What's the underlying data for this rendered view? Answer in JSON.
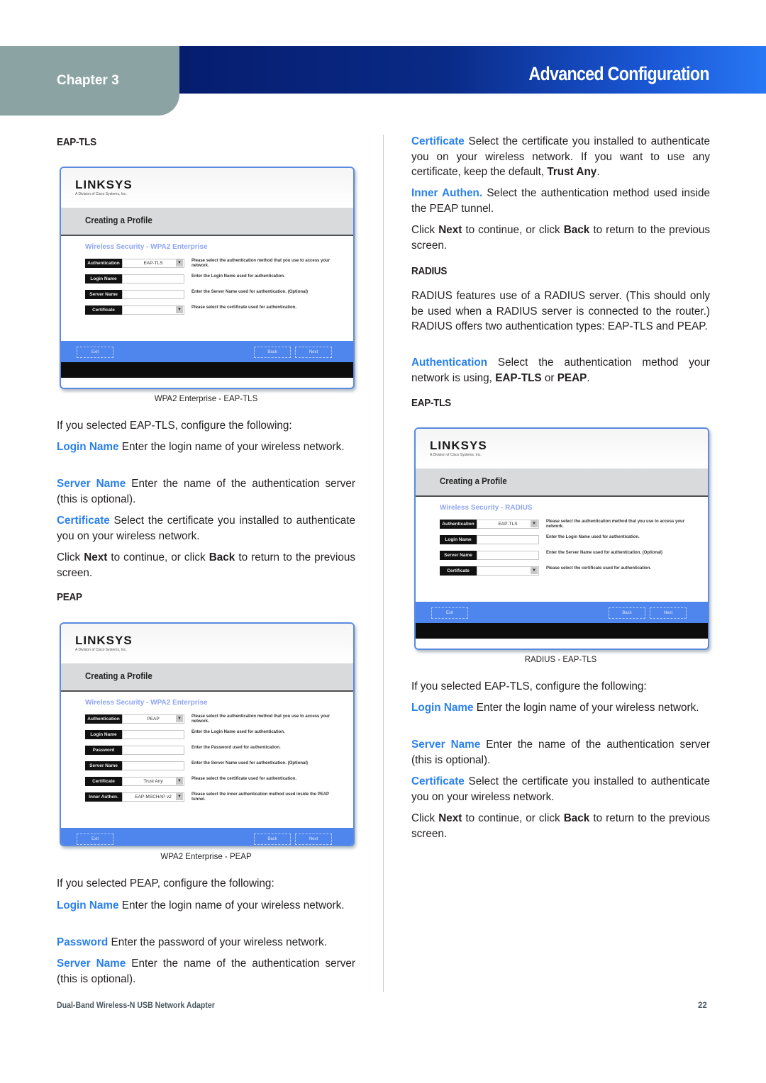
{
  "header": {
    "chapter": "Chapter 3",
    "title": "Advanced Configuration",
    "colors": {
      "chapter_tab": "#8ca3a4",
      "bar_start": "#061d6e",
      "bar_end": "#2877f4",
      "term": "#2a80ee"
    }
  },
  "left": {
    "eap_tls_heading": "EAP-TLS",
    "shot1": {
      "logo": "LINKSYS",
      "logo_sub": "A Division of Cisco Systems, Inc.",
      "band_title": "Creating a Profile",
      "section_title": "Wireless Security - WPA2 Enterprise",
      "rows": [
        {
          "label": "Authentication",
          "value": "EAP-TLS",
          "dropdown": true,
          "hint": "Please select the authentication method that you use to access your network."
        },
        {
          "label": "Login Name",
          "value": "",
          "dropdown": false,
          "hint": "Enter the Login Name used for authentication."
        },
        {
          "label": "Server Name",
          "value": "",
          "dropdown": false,
          "hint": "Enter the Server Name used for authentication. (Optional)"
        },
        {
          "label": "Certificate",
          "value": "",
          "dropdown": true,
          "hint": "Please select the certificate used for authentication."
        }
      ],
      "buttons": {
        "exit": "Exit",
        "back": "Back",
        "next": "Next"
      },
      "caption": "WPA2 Enterprise - EAP-TLS"
    },
    "intro1": "If you selected EAP-TLS, configure the following:",
    "p_login": {
      "term": "Login Name",
      "text": " Enter the login name of your wireless network."
    },
    "p_server": {
      "term": "Server Name",
      "text": "  Enter the name of the authentication server (this is optional)."
    },
    "p_cert": {
      "term": "Certificate",
      "text": " Select the certificate you installed to authenticate you on your wireless network."
    },
    "p_click": {
      "a": "Click ",
      "next": "Next",
      "b": " to continue, or click ",
      "back": "Back",
      "c": " to return to the previous screen."
    },
    "peap_heading": "PEAP",
    "shot2": {
      "logo": "LINKSYS",
      "logo_sub": "A Division of Cisco Systems, Inc.",
      "band_title": "Creating a Profile",
      "section_title": "Wireless Security - WPA2 Enterprise",
      "rows": [
        {
          "label": "Authentication",
          "value": "PEAP",
          "dropdown": true,
          "hint": "Please select the authentication method that you use to access your network."
        },
        {
          "label": "Login Name",
          "value": "",
          "dropdown": false,
          "hint": "Enter the Login Name used for authentication."
        },
        {
          "label": "Password",
          "value": "",
          "dropdown": false,
          "hint": "Enter the Password used for authentication."
        },
        {
          "label": "Server Name",
          "value": "",
          "dropdown": false,
          "hint": "Enter the Server Name used for authentication. (Optional)"
        },
        {
          "label": "Certificate",
          "value": "Trust Any",
          "dropdown": true,
          "hint": "Please select the certificate used for authentication."
        },
        {
          "label": "Inner Authen.",
          "value": "EAP-MSCHAP v2",
          "dropdown": true,
          "hint": "Please select the inner authentication method used inside the PEAP tunnel."
        }
      ],
      "buttons": {
        "exit": "Exit",
        "back": "Back",
        "next": "Next"
      },
      "caption": "WPA2 Enterprise - PEAP"
    },
    "intro2": "If you selected PEAP, configure the following:",
    "p2_login": {
      "term": "Login Name",
      "text": " Enter the login name of your wireless network."
    },
    "p2_password": {
      "term": "Password",
      "text": "  Enter the password of your wireless network."
    },
    "p2_server": {
      "term": "Server Name",
      "text": "  Enter the name of the authentication server (this is optional)."
    }
  },
  "right": {
    "p_cert": {
      "term": "Certificate",
      "text": " Select the certificate you installed to authenticate you on your wireless network. If you want to use any certificate, keep the default, ",
      "bold": "Trust Any",
      "end": "."
    },
    "p_inner": {
      "term": "Inner Authen.",
      "text": " Select the authentication method used inside the PEAP tunnel."
    },
    "p_click": {
      "a": "Click ",
      "next": "Next",
      "b": " to continue, or click ",
      "back": "Back",
      "c": " to return to the previous screen."
    },
    "radius_heading": "RADIUS",
    "radius_para": "RADIUS features use of a RADIUS server. (This should only be used when a RADIUS server is connected to the router.) RADIUS offers two authentication types: EAP-TLS and PEAP.",
    "p_auth": {
      "term": "Authentication",
      "text": "  Select the authentication method your network is using, ",
      "opt1": "EAP-TLS",
      "or": " or ",
      "opt2": "PEAP",
      "end": "."
    },
    "eap_tls_heading": "EAP-TLS",
    "shot3": {
      "logo": "LINKSYS",
      "logo_sub": "A Division of Cisco Systems, Inc.",
      "band_title": "Creating a Profile",
      "section_title": "Wireless Security - RADIUS",
      "rows": [
        {
          "label": "Authentication",
          "value": "EAP-TLS",
          "dropdown": true,
          "hint": "Please select the authentication method that you use to access your network."
        },
        {
          "label": "Login Name",
          "value": "",
          "dropdown": false,
          "hint": "Enter the Login Name used for authentication."
        },
        {
          "label": "Server Name",
          "value": "",
          "dropdown": false,
          "hint": "Enter the Server Name used for authentication. (Optional)"
        },
        {
          "label": "Certificate",
          "value": "",
          "dropdown": true,
          "hint": "Please select the certificate used for authentication."
        }
      ],
      "buttons": {
        "exit": "Exit",
        "back": "Back",
        "next": "Next"
      },
      "caption": "RADIUS - EAP-TLS"
    },
    "intro": "If you selected EAP-TLS, configure the following:",
    "p2_login": {
      "term": "Login Name",
      "text": " Enter the login name of your wireless network."
    },
    "p2_server": {
      "term": "Server Name",
      "text": "  Enter the name of the authentication server (this is optional)."
    },
    "p2_cert": {
      "term": "Certificate",
      "text": " Select the certificate you installed to authenticate you on your wireless network."
    },
    "p2_click": {
      "a": "Click ",
      "next": "Next",
      "b": " to continue, or click ",
      "back": "Back",
      "c": " to return to the previous screen."
    }
  },
  "footer": {
    "product": "Dual-Band Wireless-N USB Network Adapter",
    "page_number": "22"
  }
}
